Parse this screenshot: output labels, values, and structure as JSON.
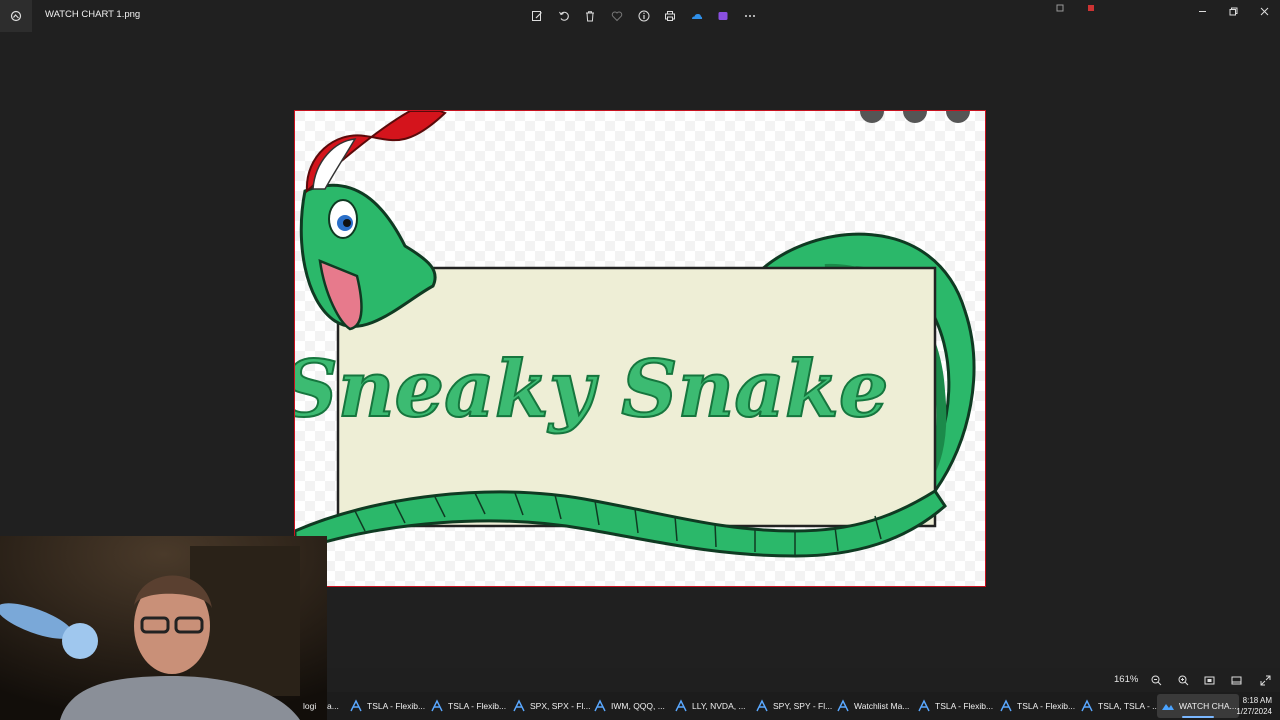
{
  "window": {
    "title": "WATCH CHART 1.png",
    "toolbar_icons": [
      "edit-icon",
      "rotate-icon",
      "delete-icon",
      "favorite-icon",
      "info-icon",
      "print-icon",
      "onedrive-icon",
      "clipchamp-icon",
      "more-icon"
    ]
  },
  "image": {
    "banner_text": "Sneaky Snake",
    "colors": {
      "snake_green": "#2bb86a",
      "snake_dark": "#1b8a4a",
      "cap_red": "#d4141c",
      "sign": "#eeeed6",
      "frame_border": "#c8101e"
    }
  },
  "status_bar": {
    "zoom": "161%"
  },
  "taskbar": {
    "login_fragment": "logi",
    "truncated_fragment": "a...",
    "items": [
      {
        "label": "TSLA - Flexib..."
      },
      {
        "label": "TSLA - Flexib..."
      },
      {
        "label": "SPX, SPX - Fl..."
      },
      {
        "label": "IWM, QQQ, ..."
      },
      {
        "label": "LLY, NVDA, ..."
      },
      {
        "label": "SPY, SPY - Fl..."
      },
      {
        "label": "Watchlist Ma..."
      },
      {
        "label": "TSLA - Flexib..."
      },
      {
        "label": "TSLA - Flexib..."
      },
      {
        "label": "TSLA, TSLA - ..."
      },
      {
        "label": "WATCH CHA..."
      }
    ],
    "clock": {
      "time": "8:18 AM",
      "date": "1/27/2024"
    }
  }
}
